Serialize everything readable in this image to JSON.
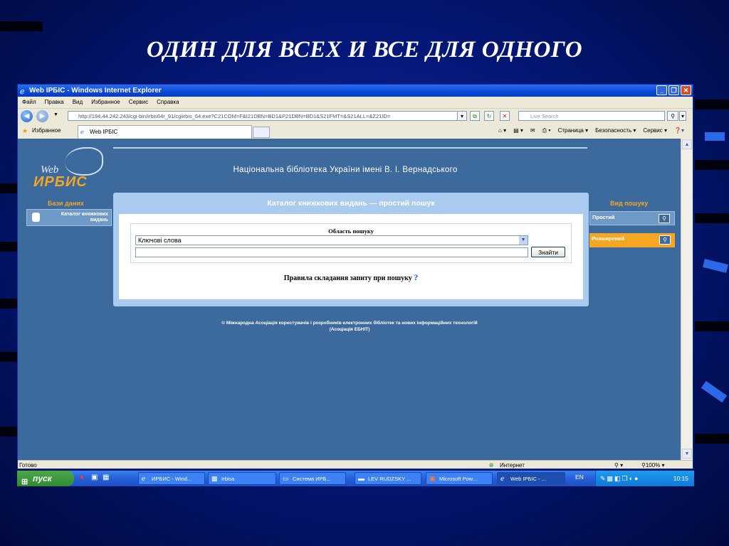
{
  "slide": {
    "title": "ОДИН ДЛЯ ВСЕХ И ВСЕ ДЛЯ ОДНОГО"
  },
  "window": {
    "title": "Web ІРБІС - Windows Internet Explorer",
    "menu": [
      "Файл",
      "Правка",
      "Вид",
      "Избранное",
      "Сервис",
      "Справка"
    ],
    "address_host": "http://194.44.242.243",
    "address_path": "/cgi-bin/irbis64r_91/cgiirbis_64.exe?C21COM=F&I21DBN=BD1&P21DBN=BD1&S21FMT=&S21ALL=&Z21ID=",
    "search_placeholder": "Live Search",
    "favorites_label": "Избранное",
    "tab_label": "Web ІРБІС",
    "commands": [
      "Страница ▾",
      "Безопасность ▾",
      "Сервис ▾"
    ],
    "status_left": "Готово",
    "status_zone": "Интернет",
    "zoom": "100%"
  },
  "page": {
    "logo_web": "Web",
    "logo_irbis": "ИРБИС",
    "library_name": "Національна бібліотека України імені В. І. Вернадського",
    "left_heading": "Бази даних",
    "left_item": "Каталог книжкових видань",
    "right_heading": "Вид пошуку",
    "right_items": [
      "Простий",
      "Розширений"
    ],
    "panel_title": "Каталог книжкових видань — простий пошук",
    "field_area_label": "Область пошуку",
    "select_value": "Ключові слова",
    "find_button": "Знайти",
    "rules_text": "Правила складання запиту при пошуку",
    "rules_mark": "?",
    "copyright_line1": "© Міжнародна Асоціація користувачів і розробників електронних бібліотек та нових інформаційних технологій",
    "copyright_line2": "(Асоціація ЕБНІТ)"
  },
  "taskbar": {
    "start": "пуск",
    "tasks": [
      "ИРБИС - Wind...",
      "Irbisa",
      "Система ИРБ...",
      "LEV RUDZSKY ...",
      "Microsoft Pow...",
      "Web ІРБІС - ..."
    ],
    "lang": "EN",
    "clock": "10:15"
  }
}
